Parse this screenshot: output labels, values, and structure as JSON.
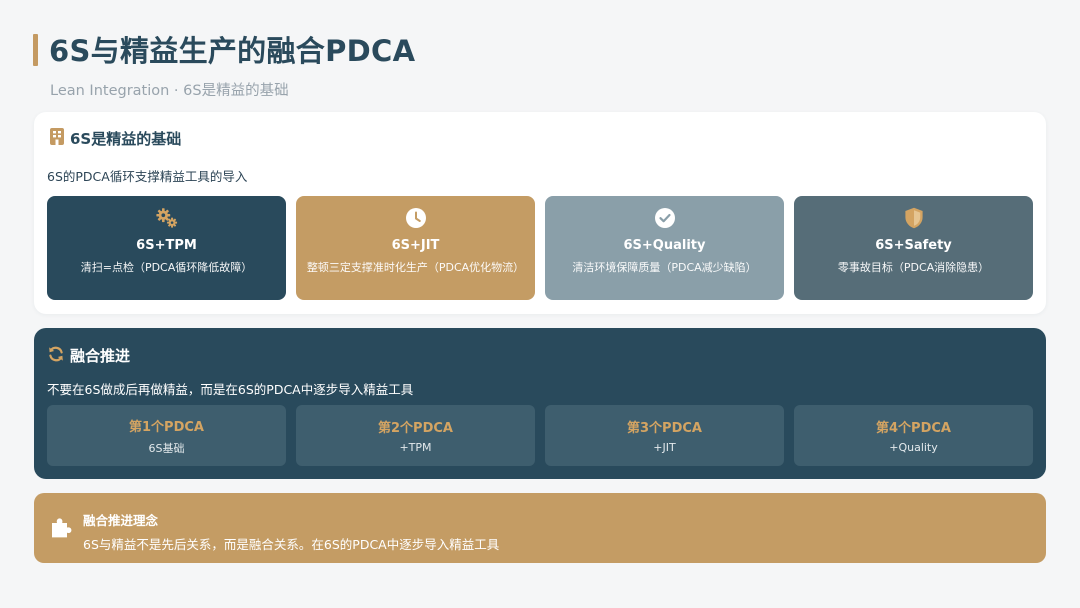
{
  "header": {
    "title": "6S与精益生产的融合PDCA",
    "subtitle": "Lean Integration · 6S是精益的基础",
    "accent_color": "#c49a62"
  },
  "foundation": {
    "icon": "building-icon",
    "heading": "6S是精益的基础",
    "description": "6S的PDCA循环支撑精益工具的导入",
    "cards": [
      {
        "icon": "gears-icon",
        "title": "6S+TPM",
        "desc": "清扫=点检（PDCA循环降低故障）",
        "color": "#294a5c"
      },
      {
        "icon": "clock-icon",
        "title": "6S+JIT",
        "desc": "整顿三定支撑准时化生产（PDCA优化物流）",
        "color": "#c49c64"
      },
      {
        "icon": "check-circle-icon",
        "title": "6S+Quality",
        "desc": "清洁环境保障质量（PDCA减少缺陷）",
        "color": "#8a9fa9"
      },
      {
        "icon": "shield-icon",
        "title": "6S+Safety",
        "desc": "零事故目标（PDCA消除隐患）",
        "color": "#566d78"
      }
    ]
  },
  "integration": {
    "icon": "refresh-icon",
    "heading": "融合推进",
    "description": "不要在6S做成后再做精益，而是在6S的PDCA中逐步导入精益工具",
    "steps": [
      {
        "title": "第1个PDCA",
        "sub": "6S基础"
      },
      {
        "title": "第2个PDCA",
        "sub": "+TPM"
      },
      {
        "title": "第3个PDCA",
        "sub": "+JIT"
      },
      {
        "title": "第4个PDCA",
        "sub": "+Quality"
      }
    ]
  },
  "concept": {
    "icon": "puzzle-icon",
    "title": "融合推进理念",
    "description": "6S与精益不是先后关系，而是融合关系。在6S的PDCA中逐步导入精益工具"
  }
}
